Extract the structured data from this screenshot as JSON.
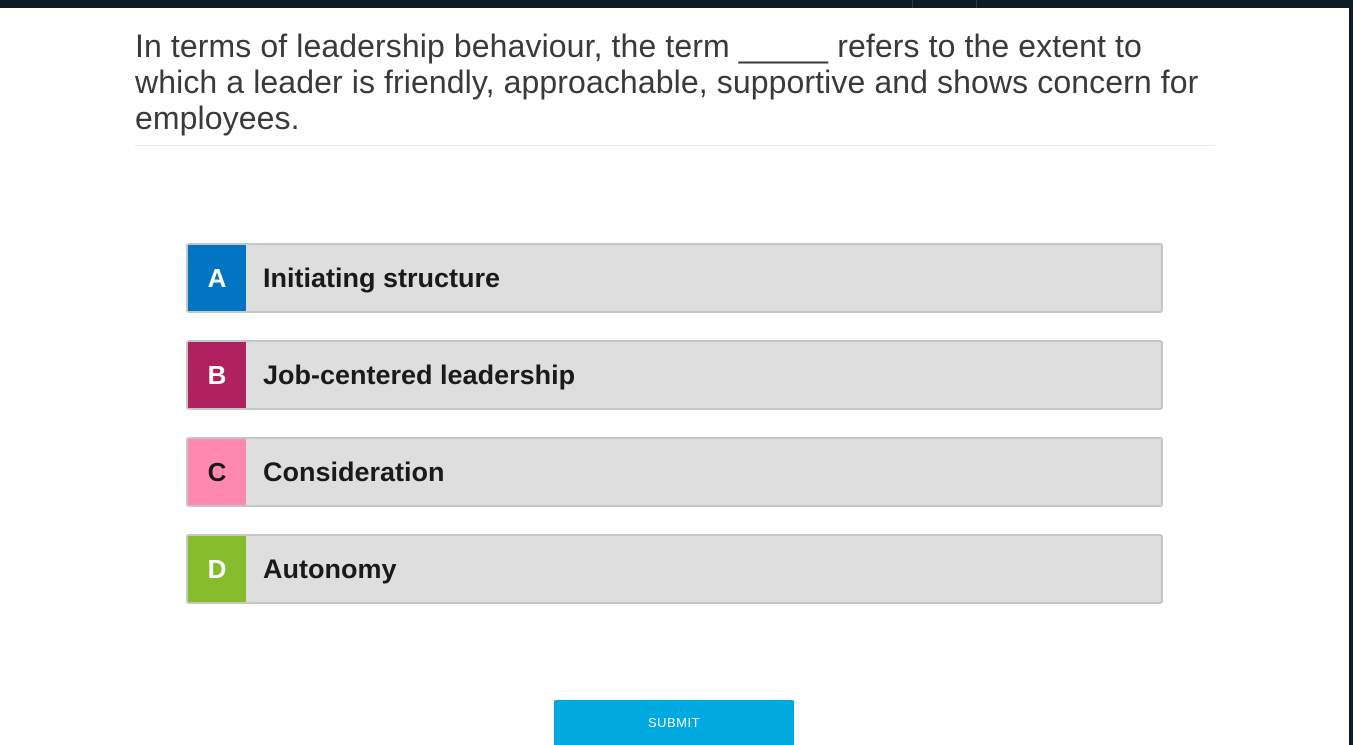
{
  "question": {
    "text": "In terms of leadership behaviour, the term _____ refers to the extent to which a leader is friendly, approachable, supportive and shows concern for employees."
  },
  "options": [
    {
      "letter": "A",
      "label": "Initiating structure",
      "color": "#0275c2",
      "letter_color": "#ffffff"
    },
    {
      "letter": "B",
      "label": "Job-centered leadership",
      "color": "#b0225e",
      "letter_color": "#ffffff"
    },
    {
      "letter": "C",
      "label": "Consideration",
      "color": "#ff88b0",
      "letter_color": "#1a1a1a"
    },
    {
      "letter": "D",
      "label": "Autonomy",
      "color": "#86bc2c",
      "letter_color": "#ffffff"
    }
  ],
  "submit": {
    "label": "SUBMIT",
    "color": "#00a9e0"
  }
}
